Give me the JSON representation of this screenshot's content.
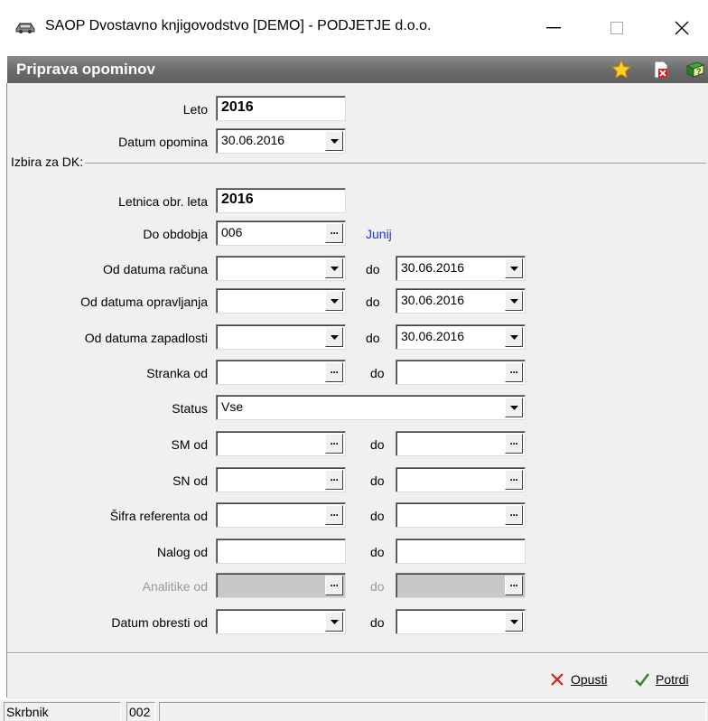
{
  "window": {
    "title": "SAOP  Dvostavno knjigovodstvo [DEMO] - PODJETJE d.o.o.",
    "minimize": "—",
    "maximize": "☐",
    "close": "✕"
  },
  "header": {
    "title": "Priprava opominov",
    "icons": [
      "star-icon",
      "delete-doc-icon",
      "help-book-icon"
    ]
  },
  "form": {
    "leto_label": "Leto",
    "leto_value": "2016",
    "datum_opomina_label": "Datum opomina",
    "datum_opomina_value": "30.06.2016",
    "group_title": "Izbira za DK:",
    "letnica_label": "Letnica obr. leta",
    "letnica_value": "2016",
    "do_obdobja_label": "Do obdobja",
    "do_obdobja_value": "006",
    "do_obdobja_info": "Junij",
    "do_label": "do",
    "od_datuma_racuna_label": "Od datuma računa",
    "od_datuma_racuna_value": "",
    "do_datuma_racuna_value": "30.06.2016",
    "od_datuma_opravljanja_label": "Od datuma opravljanja",
    "od_datuma_opravljanja_value": "",
    "do_datuma_opravljanja_value": "30.06.2016",
    "od_datuma_zapadlosti_label": "Od datuma zapadlosti",
    "od_datuma_zapadlosti_value": "",
    "do_datuma_zapadlosti_value": "30.06.2016",
    "stranka_od_label": "Stranka od",
    "status_label": "Status",
    "status_value": "Vse",
    "sm_od_label": "SM od",
    "sn_od_label": "SN od",
    "sifra_referenta_label": "Šifra referenta od",
    "nalog_od_label": "Nalog od",
    "analitike_od_label": "Analitike od",
    "datum_obresti_label": "Datum obresti od"
  },
  "footer": {
    "cancel_label": "Opusti",
    "confirm_label": "Potrdi"
  },
  "statusbar": {
    "user": "Skrbnik",
    "code": "002"
  },
  "colors": {
    "header_gradient": "#6e6e6e",
    "info_blue": "#1a33d6",
    "cancel_red": "#d42020",
    "confirm_green": "#2a8a2a"
  }
}
